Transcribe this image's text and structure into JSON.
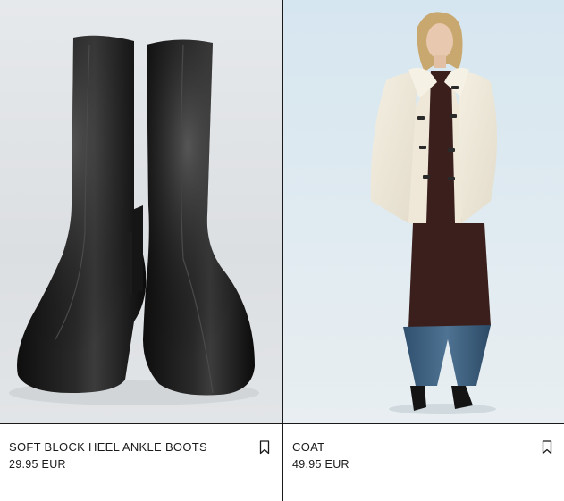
{
  "products": [
    {
      "name": "SOFT BLOCK HEEL ANKLE BOOTS",
      "price": "29.95 EUR",
      "icon": "bookmark-icon"
    },
    {
      "name": "COAT",
      "price": "49.95 EUR",
      "icon": "bookmark-icon"
    }
  ],
  "colors": {
    "text": "#1a1a1a",
    "border": "#1a1a1a",
    "boots_bg": "#dfe3e6",
    "coat_bg": "#dde8ef"
  }
}
